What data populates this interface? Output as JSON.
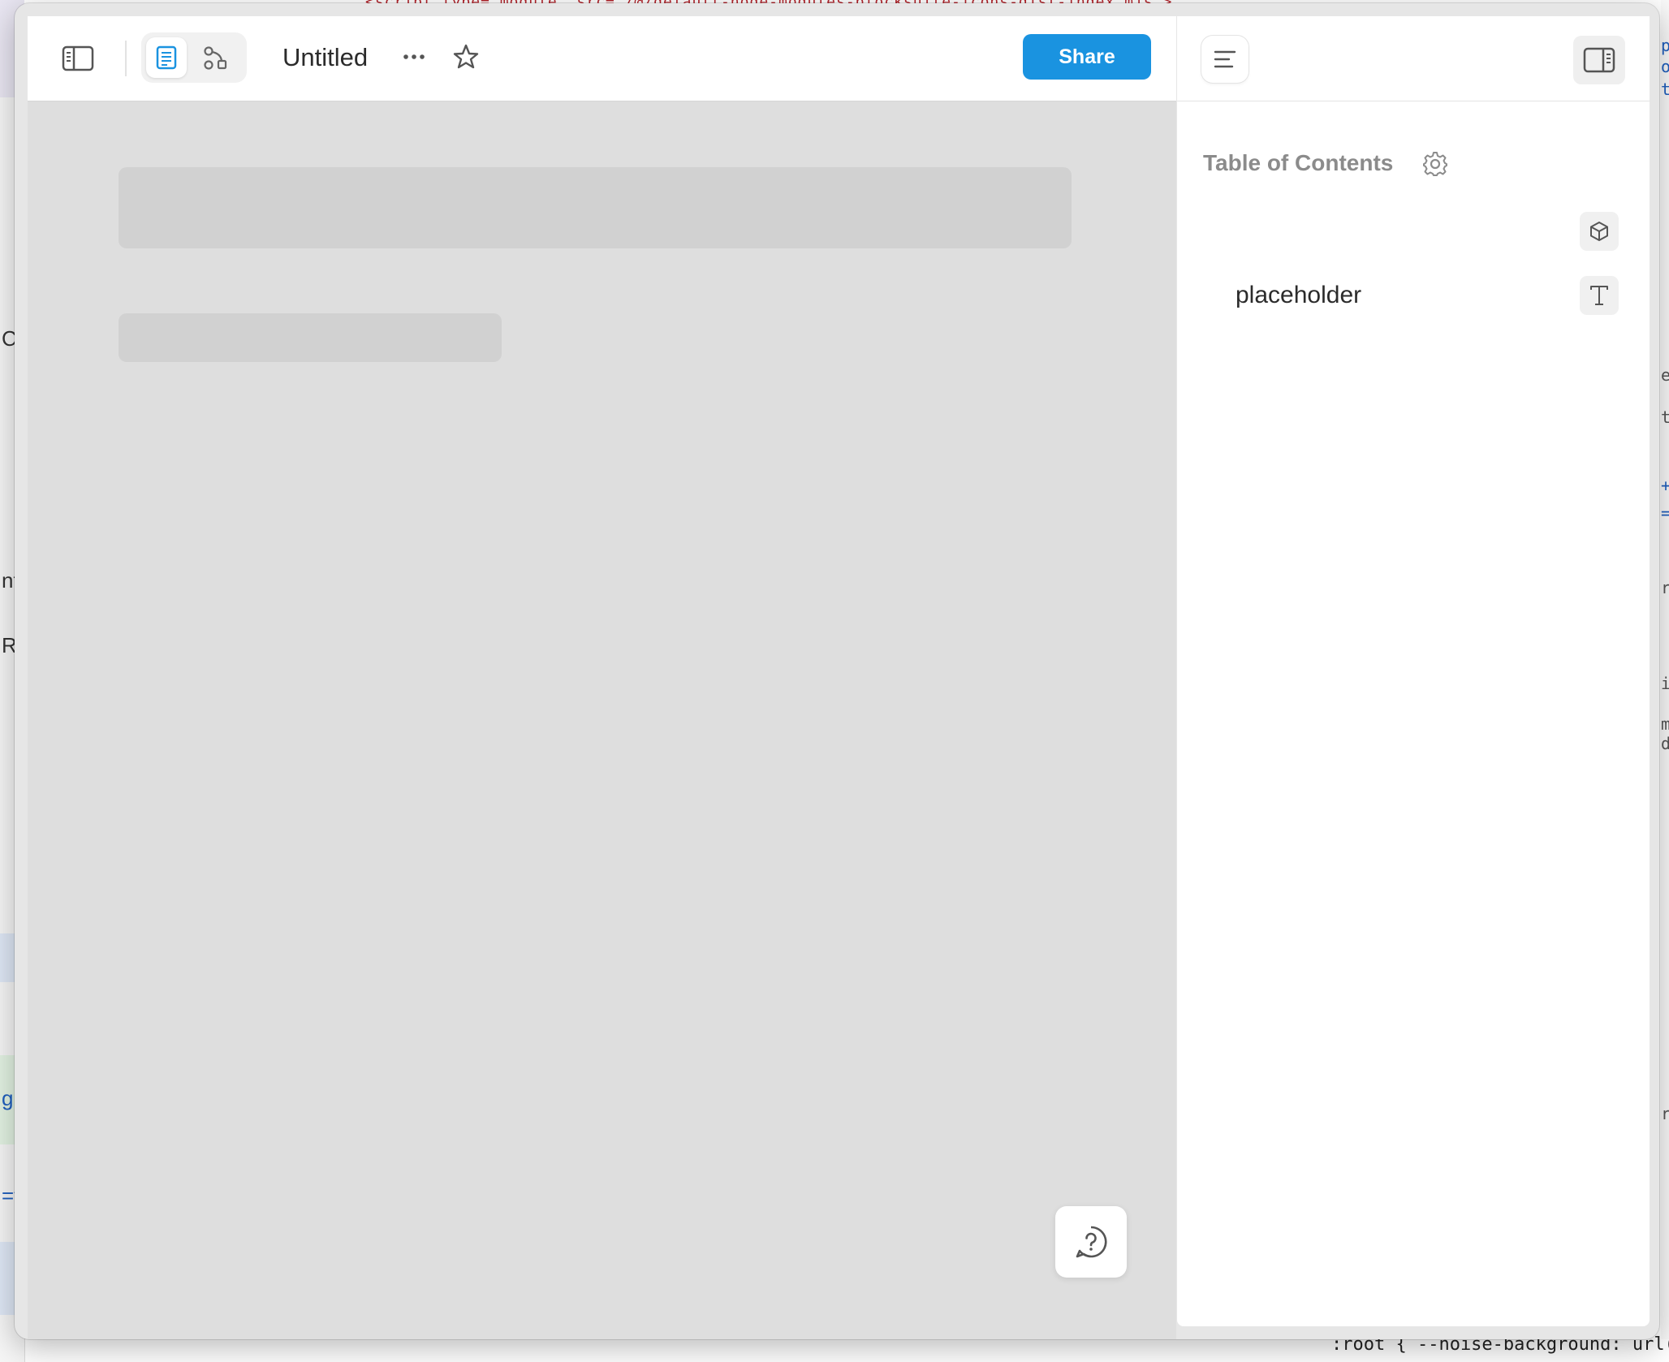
{
  "background_app": {
    "left_fragments": [
      "C",
      "nt",
      "RD",
      "gr",
      "=t"
    ],
    "top_code": "<script type=\"module\" src=\"/@/default-node-modules-blocksuite-icons-dist-index.mjs\">",
    "right_fragments": [
      "p",
      "o",
      "t",
      "e",
      "t",
      "+",
      "=",
      "r",
      "i",
      "m",
      "d",
      "r"
    ],
    "bottom_code": ":root {   --noise-background: url("
  },
  "toolbar": {
    "sidebar_toggle_icon": "sidebar-left-icon",
    "doc_mode_icon": "page-icon",
    "edgeless_mode_icon": "edgeless-icon",
    "title": "Untitled",
    "more_icon": "more-horizontal-icon",
    "favorite_icon": "star-icon",
    "share_label": "Share"
  },
  "colors": {
    "accent": "#1a93e0",
    "editor_background": "#dedede",
    "skeleton": "#d1d1d1",
    "panel_background": "#ffffff"
  },
  "right_panel": {
    "outline_icon": "outline-icon",
    "panel_toggle_icon": "sidebar-right-icon",
    "toc_title": "Table of Contents",
    "settings_icon": "gear-icon",
    "entries": [
      {
        "label": "",
        "icon": "cube-icon"
      },
      {
        "label": "placeholder",
        "icon": "text-icon"
      }
    ]
  },
  "help": {
    "icon": "help-question-icon"
  }
}
